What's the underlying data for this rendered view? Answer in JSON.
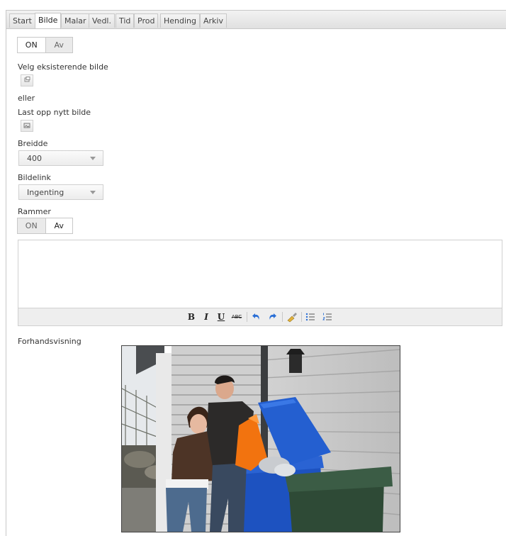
{
  "tabs": [
    {
      "label": "Start",
      "active": false
    },
    {
      "label": "Bilde",
      "active": true
    },
    {
      "label": "Malar",
      "active": false
    },
    {
      "label": "Vedl.",
      "active": false
    },
    {
      "label": "Tid",
      "active": false
    },
    {
      "label": "Prod",
      "active": false
    },
    {
      "label": "Hending",
      "active": false
    },
    {
      "label": "Arkiv",
      "active": false
    }
  ],
  "image_toggle": {
    "on_label": "ON",
    "off_label": "Av",
    "selected": "ON"
  },
  "choose_existing": {
    "label": "Velg eksisterende bilde",
    "icon": "image-browse-icon"
  },
  "or_label": "eller",
  "upload_new": {
    "label": "Last opp nytt bilde",
    "icon": "image-upload-icon"
  },
  "width": {
    "label": "Breidde",
    "value": "400"
  },
  "image_link": {
    "label": "Bildelink",
    "value": "Ingenting"
  },
  "frames": {
    "label": "Rammer",
    "on_label": "ON",
    "off_label": "Av",
    "selected": "Av"
  },
  "editor_toolbar": {
    "bold": "B",
    "italic": "I",
    "underline": "U",
    "strike": "ABC",
    "icons": [
      "bold-icon",
      "italic-icon",
      "underline-icon",
      "strikethrough-icon",
      "undo-icon",
      "redo-icon",
      "clean-format-icon",
      "bullet-list-icon",
      "numbered-list-icon"
    ]
  },
  "preview": {
    "label": "Forhandsvisning"
  },
  "colors": {
    "bin_blue": "#1a4fb8",
    "bin_green": "#2f4a35",
    "bag_orange": "#f2730f"
  }
}
